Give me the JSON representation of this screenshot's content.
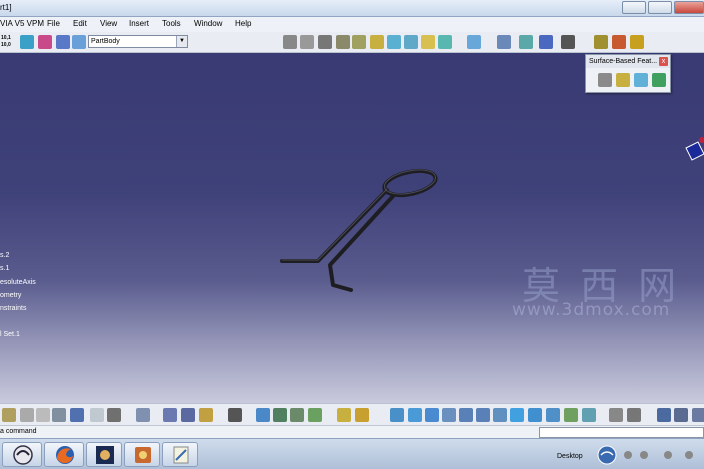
{
  "window": {
    "title": "rt1]"
  },
  "menubar": {
    "app_name": "VIA V5 VPM",
    "items": [
      "File",
      "Edit",
      "View",
      "Insert",
      "Tools",
      "Window",
      "Help"
    ]
  },
  "toolbar_top": {
    "coord_top": "10,1",
    "coord_bottom": "10,0",
    "partbody_select": "PartBody"
  },
  "spec_tree": {
    "items": [
      "s.2",
      "s.1",
      "esoluteAxis",
      "ometry",
      "nstraints",
      "l Set.1"
    ]
  },
  "floating_toolbar": {
    "title": "Surface-Based Feat...",
    "close": "x"
  },
  "watermark": {
    "chinese": "莫 西 网",
    "url": "www.3dmox.com"
  },
  "statusbar": {
    "message": "a command"
  },
  "taskbar": {
    "desktop_label": "Desktop"
  },
  "colors": {
    "viewport_top": "#393a74",
    "viewport_bottom": "#c9cadd",
    "part_color": "#2a2a2a"
  }
}
